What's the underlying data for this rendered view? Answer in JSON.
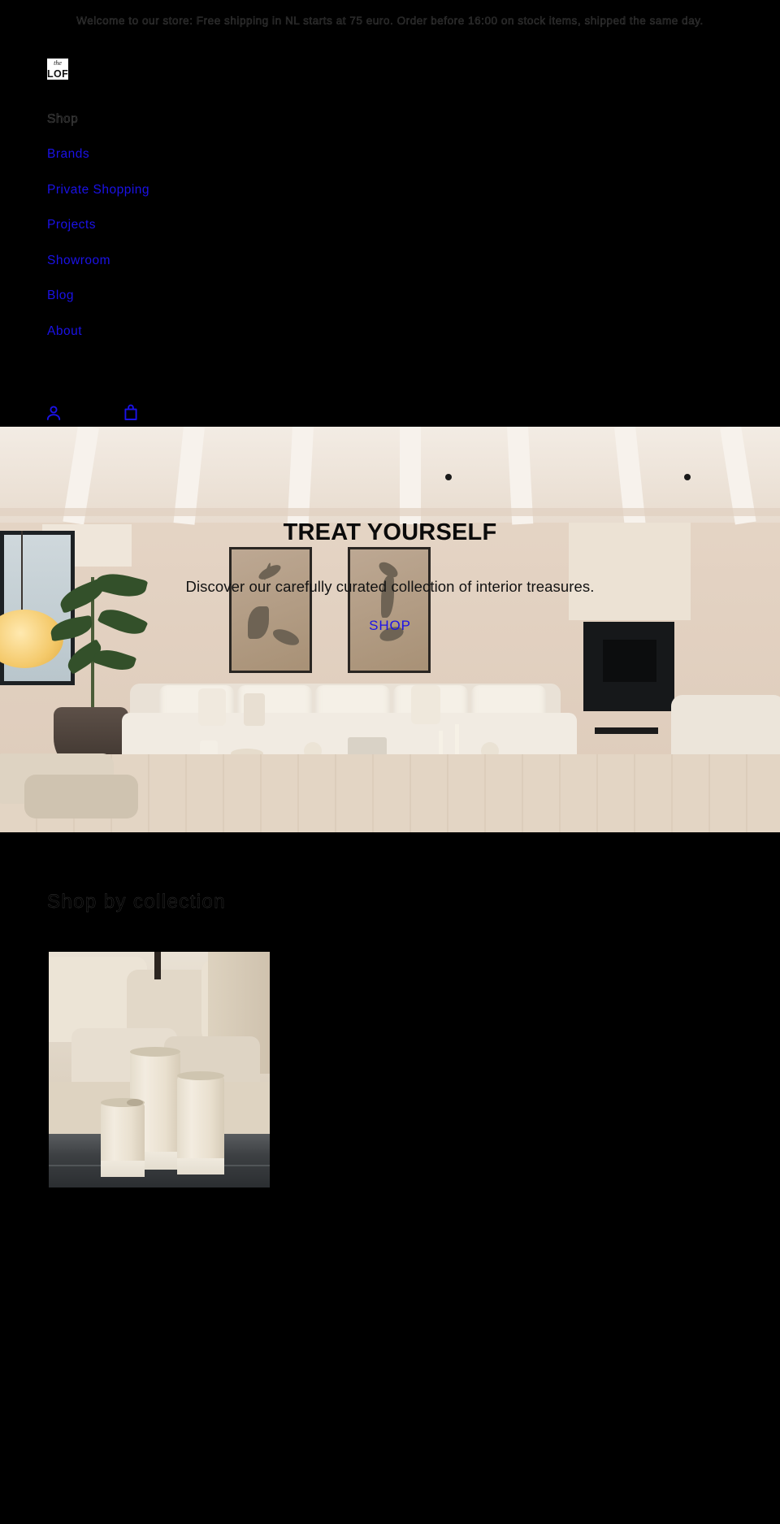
{
  "announcement": {
    "text": "Welcome to our store: Free shipping in NL starts at 75 euro. Order before 16:00 on stock items, shipped the same day."
  },
  "header": {
    "logo": {
      "line1": "the",
      "line2": "LOFT",
      "name": "the LOFT"
    },
    "nav": [
      {
        "label": "Shop",
        "style": "plain"
      },
      {
        "label": "Brands",
        "style": "link"
      },
      {
        "label": "Private Shopping",
        "style": "link"
      },
      {
        "label": "Projects",
        "style": "link"
      },
      {
        "label": "Showroom",
        "style": "link"
      },
      {
        "label": "Blog",
        "style": "link"
      },
      {
        "label": "About",
        "style": "link"
      }
    ],
    "actions": [
      {
        "icon": "account-icon",
        "label": "Account"
      },
      {
        "icon": "cart-icon",
        "label": "Cart"
      }
    ]
  },
  "hero": {
    "title": "TREAT YOURSELF",
    "subtitle": "Discover our carefully curated collection of interior treasures.",
    "cta_label": "SHOP",
    "image_alt": "Bright living room with beige sectional sofa, low black coffee table, fiddle-leaf fig plant, two framed abstract artworks and a woven rug"
  },
  "collection": {
    "heading": "Shop by collection",
    "cards": [
      {
        "image_alt": "Three cream alabaster pillar candle holders on a dark wooden table in front of beige cushions"
      }
    ]
  },
  "colors": {
    "page_background": "#000000",
    "link_blue": "#1b12e8",
    "muted_text": "#1a1a1a",
    "hero_title": "#0b0b0b",
    "logo_background": "#ffffff"
  }
}
